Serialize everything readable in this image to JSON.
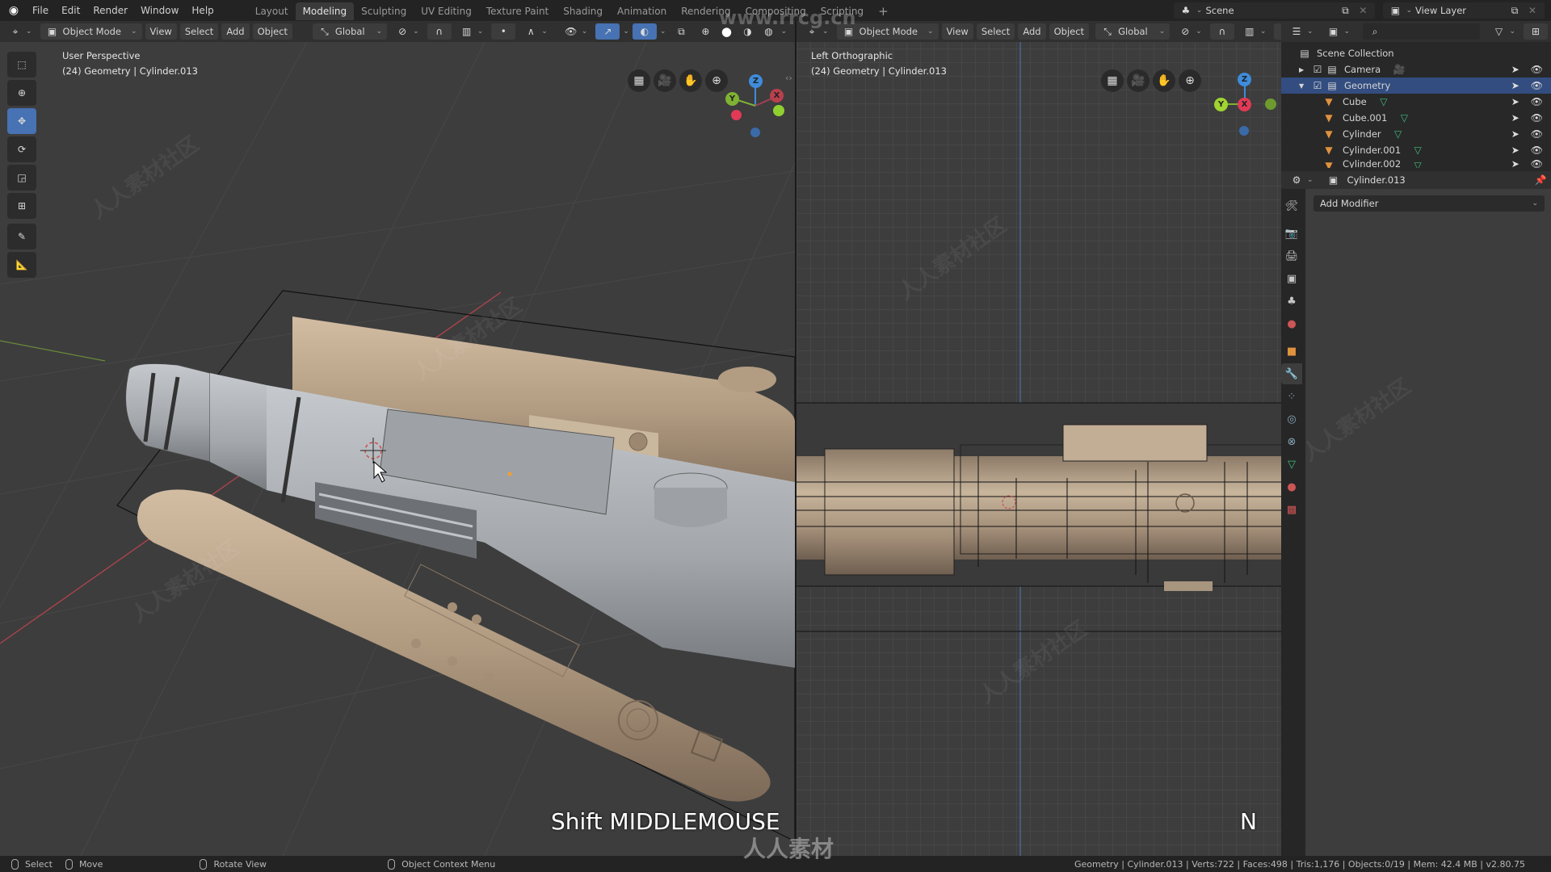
{
  "topbar": {
    "menu": [
      "File",
      "Edit",
      "Render",
      "Window",
      "Help"
    ],
    "workspaces": [
      "Layout",
      "Modeling",
      "Sculpting",
      "UV Editing",
      "Texture Paint",
      "Shading",
      "Animation",
      "Rendering",
      "Compositing",
      "Scripting"
    ],
    "active_workspace": "Modeling",
    "add_workspace": "+",
    "scene_label": "Scene",
    "view_layer_label": "View Layer"
  },
  "left_viewport": {
    "mode": "Object Mode",
    "menus": [
      "View",
      "Select",
      "Add",
      "Object"
    ],
    "orientation": "Global",
    "view_name": "User Perspective",
    "object_info": "(24) Geometry | Cylinder.013",
    "gizmo": {
      "x": "X",
      "y": "Y",
      "z": "Z"
    },
    "caption": "Shift MIDDLEMOUSE"
  },
  "right_viewport": {
    "mode": "Object Mode",
    "menus": [
      "View",
      "Select",
      "Add",
      "Object"
    ],
    "orientation": "Global",
    "view_name": "Left Orthographic",
    "object_info": "(24) Geometry | Cylinder.013",
    "gizmo": {
      "x": "X",
      "y": "Y",
      "z": "Z"
    },
    "caption": "N"
  },
  "tools": [
    "select-box",
    "cursor",
    "move",
    "rotate",
    "scale",
    "transform",
    "annotate",
    "measure"
  ],
  "active_tool": "move",
  "outliner": {
    "root": "Scene Collection",
    "items": [
      {
        "name": "Camera",
        "type": "collection",
        "expanded": false,
        "checked": true,
        "badge": "camera"
      },
      {
        "name": "Geometry",
        "type": "collection",
        "expanded": true,
        "checked": true,
        "selected": true
      },
      {
        "name": "Cube",
        "type": "mesh",
        "indent": 1
      },
      {
        "name": "Cube.001",
        "type": "mesh",
        "indent": 1
      },
      {
        "name": "Cylinder",
        "type": "mesh",
        "indent": 1
      },
      {
        "name": "Cylinder.001",
        "type": "mesh",
        "indent": 1
      },
      {
        "name": "Cylinder.002",
        "type": "mesh",
        "indent": 1
      }
    ]
  },
  "properties": {
    "object_name": "Cylinder.013",
    "add_modifier": "Add Modifier",
    "tabs": [
      "tool",
      "render",
      "output",
      "view-layer",
      "scene",
      "world",
      "object",
      "modifiers",
      "particles",
      "physics",
      "constraints",
      "data",
      "material",
      "texture"
    ],
    "active_tab": "modifiers"
  },
  "status": {
    "hints": [
      {
        "icon": "mouse-left",
        "label": "Select"
      },
      {
        "icon": "mouse-drag",
        "label": "Move"
      },
      {
        "icon": "mouse-middle",
        "label": "Rotate View"
      },
      {
        "icon": "mouse-right",
        "label": "Object Context Menu"
      }
    ],
    "stats": "Geometry | Cylinder.013 | Verts:722 | Faces:498 | Tris:1,176 | Objects:0/19 | Mem: 42.4 MB | v2.80.75"
  },
  "watermark": {
    "url": "www.rrcg.cn",
    "brand": "人人素材",
    "pattern": "人人素材社区"
  },
  "colors": {
    "accent": "#4772b3",
    "axis_x": "#d7404f",
    "axis_y": "#7fb233",
    "axis_z": "#3e8cdb",
    "model_tan": "#b09a82",
    "model_grey": "#a8acb0"
  }
}
